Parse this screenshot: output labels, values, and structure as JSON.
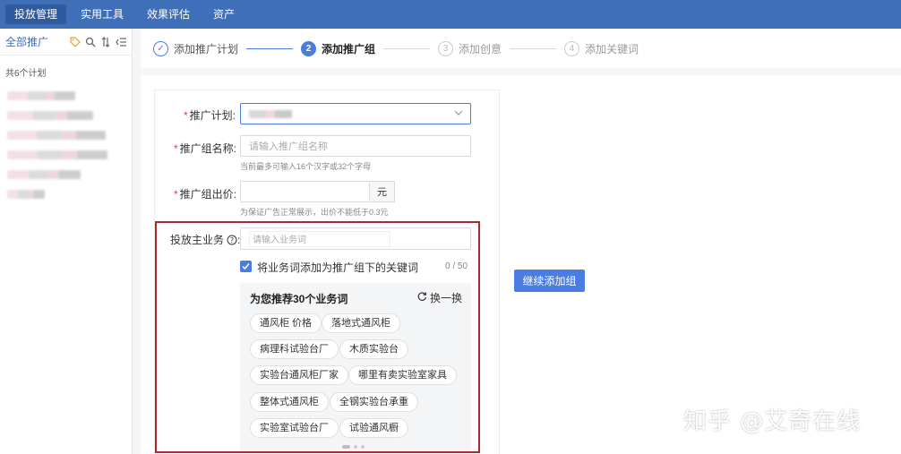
{
  "topnav": [
    "投放管理",
    "实用工具",
    "效果评估",
    "资产"
  ],
  "sidebar": {
    "all_label": "全部推广",
    "plan_count": "共6个计划"
  },
  "steps": [
    {
      "num": "✓",
      "label": "添加推广计划"
    },
    {
      "num": "2",
      "label": "添加推广组"
    },
    {
      "num": "3",
      "label": "添加创意"
    },
    {
      "num": "4",
      "label": "添加关键词"
    }
  ],
  "form": {
    "plan_label": "推广计划:",
    "group_name_label": "推广组名称:",
    "group_name_placeholder": "请输入推广组名称",
    "group_name_hint": "当前最多可输入16个汉字或32个字母",
    "bid_label": "推广组出价:",
    "bid_unit": "元",
    "bid_hint": "为保证广告正常展示，出价不能低于0.3元",
    "business_label": "投放主业务",
    "business_placeholder": "请输入业务词",
    "checkbox_label": "将业务词添加为推广组下的关键词",
    "counter": "0 / 50"
  },
  "recommend": {
    "title": "为您推荐30个业务词",
    "refresh_label": "换一换",
    "tags": [
      "通风柜 价格",
      "落地式通风柜",
      "病理科试验台厂",
      "木质实验台",
      "实验台通风柜厂家",
      "哪里有卖实验室家具",
      "整体式通风柜",
      "全钢实验台承重",
      "实验室试验台厂",
      "试验通风橱"
    ]
  },
  "continue_button": "继续添加组",
  "watermark": "知乎 @艾奇在线"
}
